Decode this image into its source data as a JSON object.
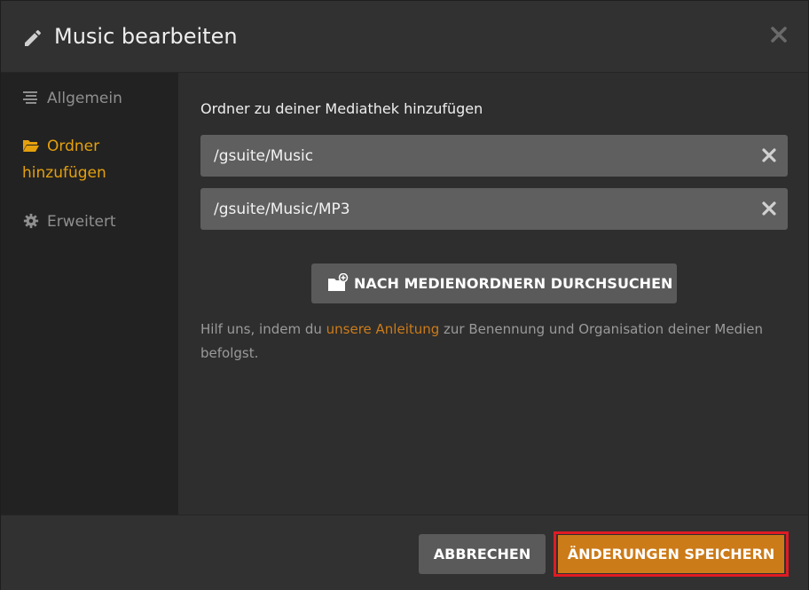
{
  "header": {
    "title": "Music bearbeiten",
    "icon": "pencil-icon",
    "close_icon": "close-icon"
  },
  "sidebar": {
    "items": [
      {
        "label": "Allgemein",
        "icon": "lines-icon",
        "active": false
      },
      {
        "label": "Ordner hinzufügen",
        "icon": "folder-open-icon",
        "active": true
      },
      {
        "label": "Erweitert",
        "icon": "gear-icon",
        "active": false
      }
    ]
  },
  "content": {
    "section_label": "Ordner zu deiner Mediathek hinzufügen",
    "folders": [
      {
        "path": "/gsuite/Music"
      },
      {
        "path": "/gsuite/Music/MP3"
      }
    ],
    "browse_button_label": "NACH MEDIENORDNERN DURCHSUCHEN",
    "help": {
      "before": "Hilf uns, indem du ",
      "link": "unsere Anleitung",
      "after": " zur Benennung und Organisation deiner Medien befolgst."
    }
  },
  "footer": {
    "cancel_label": "ABBRECHEN",
    "save_label": "ÄNDERUNGEN SPEICHERN"
  },
  "colors": {
    "accent": "#e5a00d",
    "link": "#cc7b19",
    "save_button": "#cc7b19",
    "highlight_border": "#e01b24"
  }
}
